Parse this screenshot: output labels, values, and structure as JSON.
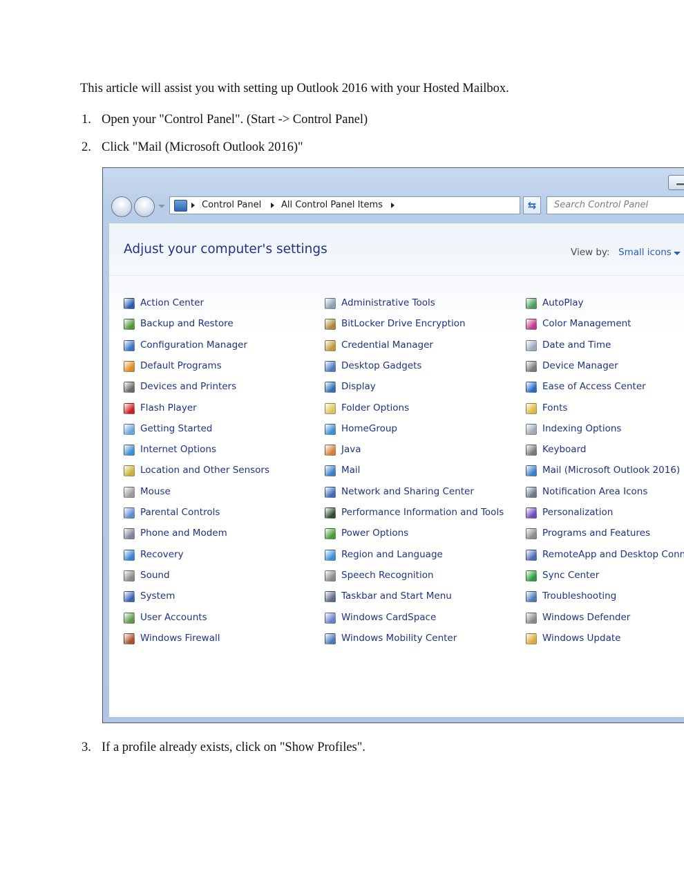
{
  "intro": "This article will assist you with setting up Outlook 2016 with your Hosted Mailbox.",
  "steps": [
    {
      "num": "1.",
      "text": "Open your \"Control Panel\". (Start -> Control Panel)"
    },
    {
      "num": "2.",
      "text": "Click \"Mail (Microsoft Outlook 2016)\""
    },
    {
      "num": "3.",
      "text": "If a profile already exists, click on \"Show Profiles\"."
    }
  ],
  "control_panel": {
    "breadcrumb": [
      "Control Panel",
      "All Control Panel Items"
    ],
    "search_placeholder": "Search Control Panel",
    "heading": "Adjust your computer's settings",
    "view_by_label": "View by:",
    "view_by_value": "Small icons",
    "columns": [
      [
        {
          "label": "Action Center",
          "icon": "flag-icon",
          "color": "#2a5db0"
        },
        {
          "label": "Backup and Restore",
          "icon": "backup-icon",
          "color": "#4f9a3c"
        },
        {
          "label": "Configuration Manager",
          "icon": "config-icon",
          "color": "#3a74c4"
        },
        {
          "label": "Default Programs",
          "icon": "default-programs-icon",
          "color": "#e08a1e"
        },
        {
          "label": "Devices and Printers",
          "icon": "printer-icon",
          "color": "#6b6b6b"
        },
        {
          "label": "Flash Player",
          "icon": "flash-icon",
          "color": "#d21f1f"
        },
        {
          "label": "Getting Started",
          "icon": "getting-started-icon",
          "color": "#6aa6de"
        },
        {
          "label": "Internet Options",
          "icon": "internet-icon",
          "color": "#3c8fd6"
        },
        {
          "label": "Location and Other Sensors",
          "icon": "sensor-icon",
          "color": "#c9b23a"
        },
        {
          "label": "Mouse",
          "icon": "mouse-icon",
          "color": "#9a9a9a"
        },
        {
          "label": "Parental Controls",
          "icon": "parental-icon",
          "color": "#5c8fd0"
        },
        {
          "label": "Phone and Modem",
          "icon": "phone-icon",
          "color": "#7b8797"
        },
        {
          "label": "Recovery",
          "icon": "recovery-icon",
          "color": "#3a84d6"
        },
        {
          "label": "Sound",
          "icon": "speaker-icon",
          "color": "#8a8a8a"
        },
        {
          "label": "System",
          "icon": "system-icon",
          "color": "#3b63b8"
        },
        {
          "label": "User Accounts",
          "icon": "users-icon",
          "color": "#5d9a4a"
        },
        {
          "label": "Windows Firewall",
          "icon": "firewall-icon",
          "color": "#a8502a"
        }
      ],
      [
        {
          "label": "Administrative Tools",
          "icon": "admin-tools-icon",
          "color": "#8aa0b8"
        },
        {
          "label": "BitLocker Drive Encryption",
          "icon": "bitlocker-icon",
          "color": "#b0883a"
        },
        {
          "label": "Credential Manager",
          "icon": "credential-icon",
          "color": "#c29a3a"
        },
        {
          "label": "Desktop Gadgets",
          "icon": "gadgets-icon",
          "color": "#4a7bc4"
        },
        {
          "label": "Display",
          "icon": "display-icon",
          "color": "#2f6fb8"
        },
        {
          "label": "Folder Options",
          "icon": "folder-icon",
          "color": "#e2c25a"
        },
        {
          "label": "HomeGroup",
          "icon": "homegroup-icon",
          "color": "#3f8fd0"
        },
        {
          "label": "Java",
          "icon": "java-icon",
          "color": "#d0823a"
        },
        {
          "label": "Mail",
          "icon": "mail-icon",
          "color": "#3a7fc8"
        },
        {
          "label": "Network and Sharing Center",
          "icon": "network-icon",
          "color": "#3d6db8"
        },
        {
          "label": "Performance Information and Tools",
          "icon": "performance-icon",
          "color": "#2d4f2d"
        },
        {
          "label": "Power Options",
          "icon": "power-icon",
          "color": "#4a9a3a"
        },
        {
          "label": "Region and Language",
          "icon": "region-icon",
          "color": "#3c8fd6"
        },
        {
          "label": "Speech Recognition",
          "icon": "microphone-icon",
          "color": "#8a8a8a"
        },
        {
          "label": "Taskbar and Start Menu",
          "icon": "taskbar-icon",
          "color": "#5a6a80"
        },
        {
          "label": "Windows CardSpace",
          "icon": "cardspace-icon",
          "color": "#6a7fc8"
        },
        {
          "label": "Windows Mobility Center",
          "icon": "mobility-icon",
          "color": "#4a7ab8"
        }
      ],
      [
        {
          "label": "AutoPlay",
          "icon": "autoplay-icon",
          "color": "#4a9a5a"
        },
        {
          "label": "Color Management",
          "icon": "color-management-icon",
          "color": "#c23a8a"
        },
        {
          "label": "Date and Time",
          "icon": "clock-icon",
          "color": "#9aaac0"
        },
        {
          "label": "Device Manager",
          "icon": "device-manager-icon",
          "color": "#7a7a7a"
        },
        {
          "label": "Ease of Access Center",
          "icon": "ease-of-access-icon",
          "color": "#2a6ac4"
        },
        {
          "label": "Fonts",
          "icon": "fonts-icon",
          "color": "#e0b83a"
        },
        {
          "label": "Indexing Options",
          "icon": "indexing-icon",
          "color": "#9aa8b8"
        },
        {
          "label": "Keyboard",
          "icon": "keyboard-icon",
          "color": "#7a7a7a"
        },
        {
          "label": "Mail (Microsoft Outlook 2016)",
          "icon": "mail-icon",
          "color": "#3a7fc8"
        },
        {
          "label": "Notification Area Icons",
          "icon": "notification-icon",
          "color": "#6a7a8a"
        },
        {
          "label": "Personalization",
          "icon": "personalization-icon",
          "color": "#6a4ab8"
        },
        {
          "label": "Programs and Features",
          "icon": "programs-icon",
          "color": "#8a8a8a"
        },
        {
          "label": "RemoteApp and Desktop Conne",
          "icon": "remoteapp-icon",
          "color": "#4a6ab8"
        },
        {
          "label": "Sync Center",
          "icon": "sync-icon",
          "color": "#2e9a3a"
        },
        {
          "label": "Troubleshooting",
          "icon": "troubleshooting-icon",
          "color": "#4a7ab8"
        },
        {
          "label": "Windows Defender",
          "icon": "defender-icon",
          "color": "#8a8a8a"
        },
        {
          "label": "Windows Update",
          "icon": "update-icon",
          "color": "#e0a83a"
        }
      ]
    ]
  }
}
